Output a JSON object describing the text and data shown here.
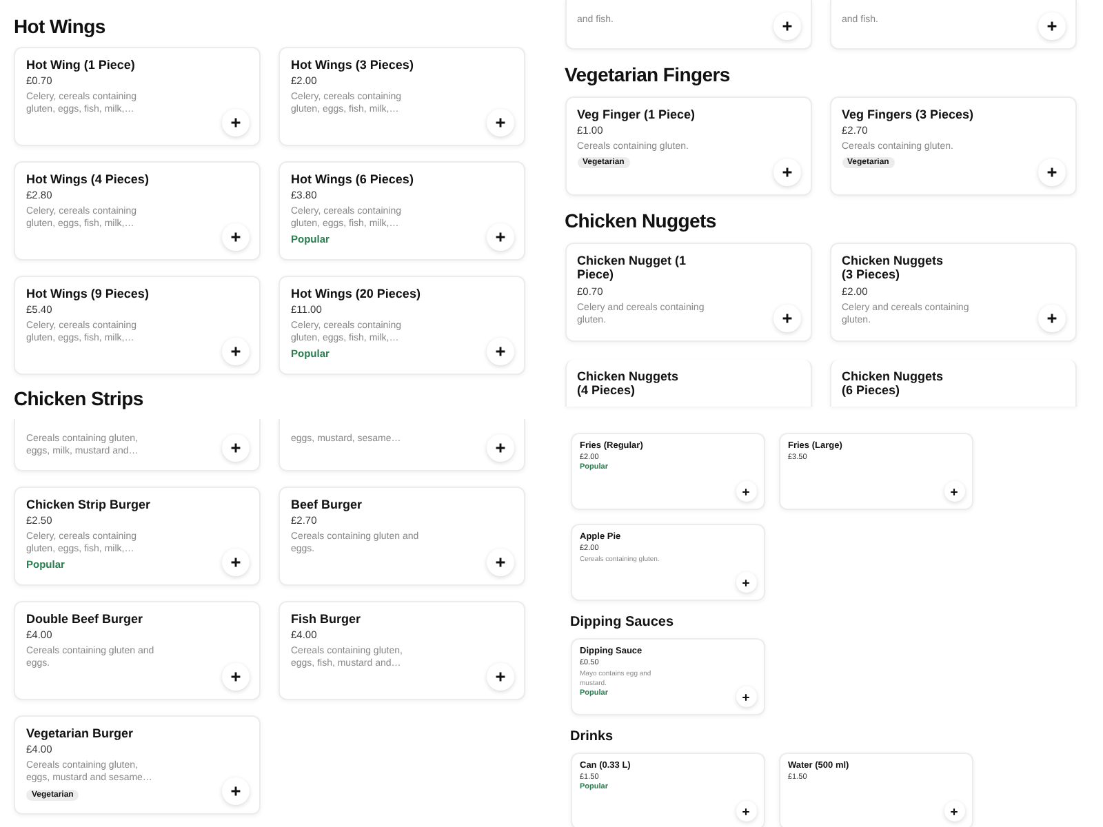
{
  "columns": [
    [
      {
        "sections": [
          {
            "heading": "Hot Wings",
            "items": [
              {
                "title": "Hot Wing (1 Piece)",
                "price": "£0.70",
                "description": "Celery, cereals containing gluten, eggs, fish, milk,…"
              },
              {
                "title": "Hot Wings (3 Pieces)",
                "price": "£2.00",
                "description": "Celery, cereals containing gluten, eggs, fish, milk,…"
              },
              {
                "title": "Hot Wings (4 Pieces)",
                "price": "£2.80",
                "description": "Celery, cereals containing gluten, eggs, fish, milk,…"
              },
              {
                "title": "Hot Wings (6 Pieces)",
                "price": "£3.80",
                "description": "Celery, cereals containing gluten, eggs, fish, milk,…",
                "badge": "Popular"
              },
              {
                "title": "Hot Wings (9 Pieces)",
                "price": "£5.40",
                "description": "Celery, cereals containing gluten, eggs, fish, milk,…"
              },
              {
                "title": "Hot Wings (20 Pieces)",
                "price": "£11.00",
                "description": "Celery, cereals containing gluten, eggs, fish, milk,…",
                "badge": "Popular"
              }
            ]
          },
          {
            "heading": "Chicken Strips"
          }
        ]
      },
      {
        "sections": [
          {
            "items": [
              {
                "description": "Cereals containing gluten, eggs, milk, mustard and…"
              },
              {
                "description": "eggs, mustard, sesame…"
              },
              {
                "title": "Chicken Strip Burger",
                "price": "£2.50",
                "description": "Celery, cereals containing gluten, eggs, fish, milk,…",
                "badge": "Popular"
              },
              {
                "title": "Beef Burger",
                "price": "£2.70",
                "description": "Cereals containing gluten and eggs."
              },
              {
                "title": "Double Beef Burger",
                "price": "£4.00",
                "description": "Cereals containing gluten and eggs."
              },
              {
                "title": "Fish Burger",
                "price": "£4.00",
                "description": "Cereals containing gluten, eggs, fish, mustard and…"
              },
              {
                "title": "Vegetarian Burger",
                "price": "£4.00",
                "description": "Cereals containing gluten, eggs, mustard and sesame…",
                "tag": "Vegetarian"
              }
            ]
          }
        ]
      }
    ],
    [
      {
        "sections": [
          {
            "items": [
              {
                "description": "and fish."
              },
              {
                "description": "and fish."
              }
            ]
          },
          {
            "heading": "Vegetarian Fingers",
            "items": [
              {
                "title": "Veg Finger (1 Piece)",
                "price": "£1.00",
                "description": "Cereals containing gluten.",
                "tag": "Vegetarian"
              },
              {
                "title": "Veg Fingers (3 Pieces)",
                "price": "£2.70",
                "description": "Cereals containing gluten.",
                "tag": "Vegetarian"
              }
            ]
          },
          {
            "heading": "Chicken Nuggets",
            "items": [
              {
                "title": "Chicken Nugget (1 Piece)",
                "price": "£0.70",
                "description": "Celery and cereals containing gluten."
              },
              {
                "title": "Chicken Nuggets (3 Pieces)",
                "price": "£2.00",
                "description": "Celery and cereals containing gluten."
              },
              {
                "title": "Chicken Nuggets (4 Pieces)"
              },
              {
                "title": "Chicken Nuggets (6 Pieces)"
              }
            ]
          }
        ]
      },
      {
        "sections": [
          {
            "items": [
              {
                "title": "Fries (Regular)",
                "price": "£2.00",
                "badge": "Popular"
              },
              {
                "title": "Fries (Large)",
                "price": "£3.50"
              },
              {
                "title": "Apple Pie",
                "price": "£2.00",
                "description": "Cereals containing gluten."
              }
            ]
          },
          {
            "heading": "Dipping Sauces",
            "items": [
              {
                "title": "Dipping Sauce",
                "price": "£0.50",
                "description": "Mayo contains egg and mustard.",
                "badge": "Popular"
              }
            ]
          },
          {
            "heading": "Drinks",
            "items": [
              {
                "title": "Can (0.33 L)",
                "price": "£1.50",
                "badge": "Popular"
              },
              {
                "title": "Water (500 ml)",
                "price": "£1.50"
              }
            ]
          }
        ]
      }
    ]
  ]
}
